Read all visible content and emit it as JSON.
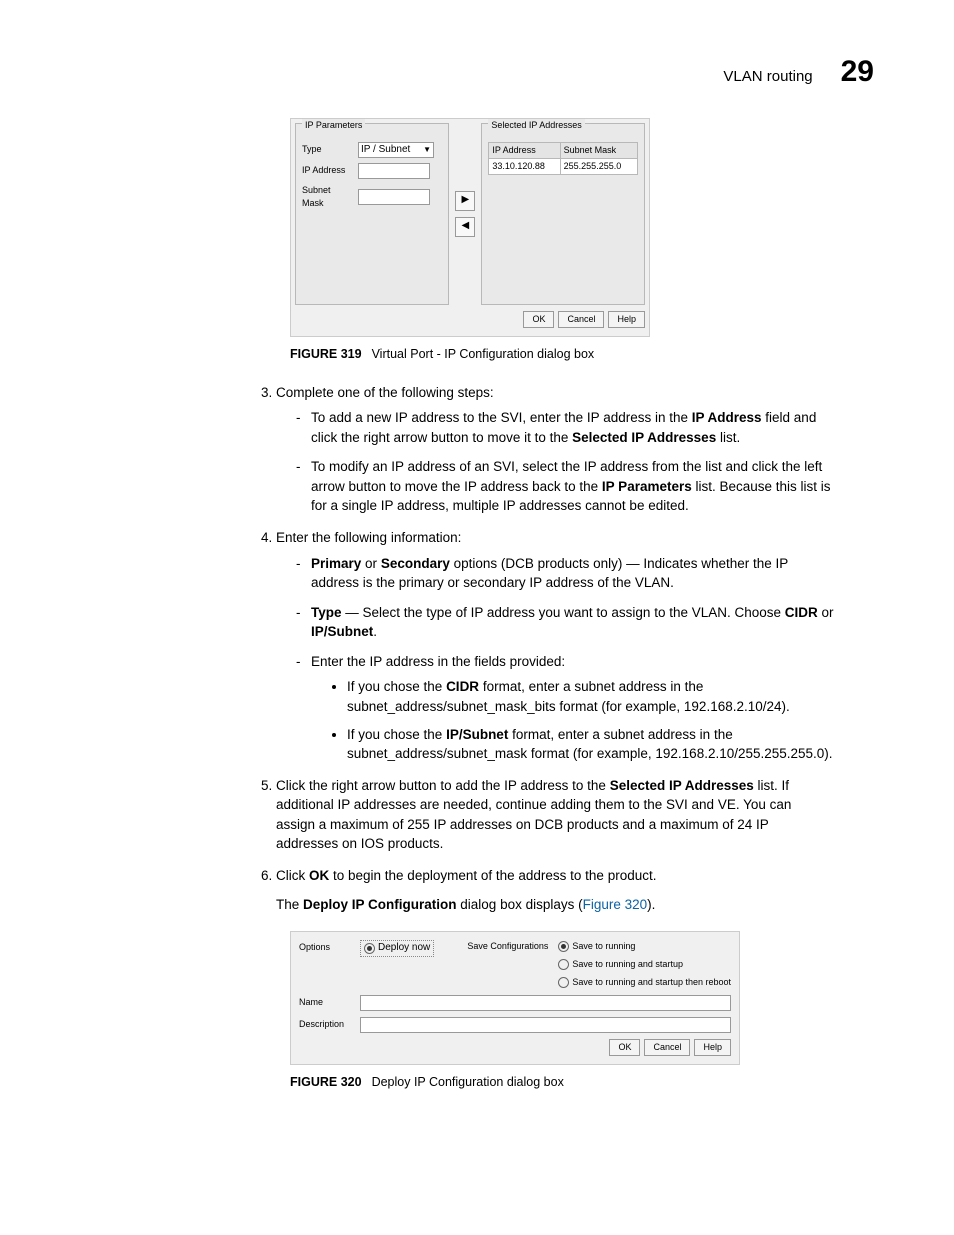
{
  "header": {
    "title": "VLAN routing",
    "chapter": "29"
  },
  "fig319": {
    "caption_label": "FIGURE 319",
    "caption_text": "Virtual Port - IP Configuration dialog box",
    "ip_params_legend": "IP Parameters",
    "type_label": "Type",
    "type_value": "IP / Subnet",
    "ip_label": "IP Address",
    "mask_label": "Subnet Mask",
    "sel_legend": "Selected IP Addresses",
    "col_ip": "IP Address",
    "col_mask": "Subnet Mask",
    "row_ip": "33.10.120.88",
    "row_mask": "255.255.255.0",
    "ok": "OK",
    "cancel": "Cancel",
    "help": "Help"
  },
  "steps": {
    "s3": "Complete one of the following steps:",
    "s3a_pre": "To add a new IP address to the SVI, enter the IP address in the ",
    "s3a_b1": "IP Address",
    "s3a_mid": " field and click the right arrow button to move it to the ",
    "s3a_b2": "Selected IP Addresses",
    "s3a_post": " list.",
    "s3b_pre": "To modify an IP address of an SVI, select the IP address from the list and click the left arrow button to move the IP address back to the ",
    "s3b_b1": "IP Parameters",
    "s3b_post": " list. Because this list is for a single IP address, multiple IP addresses cannot be edited.",
    "s4": "Enter the following information:",
    "s4a_b1": "Primary",
    "s4a_or": " or ",
    "s4a_b2": "Secondary",
    "s4a_txt": " options (DCB products only) — Indicates whether the IP address is the primary or secondary IP address of the VLAN.",
    "s4b_b1": "Type",
    "s4b_mid": " — Select the type of IP address you want to assign to the VLAN. Choose ",
    "s4b_b2": "CIDR",
    "s4b_or": " or ",
    "s4b_b3": "IP/Subnet",
    "s4b_post": ".",
    "s4c": "Enter the IP address in the fields provided:",
    "s4c1_pre": "If you chose the ",
    "s4c1_b": "CIDR",
    "s4c1_post": " format, enter a subnet address in the subnet_address/subnet_mask_bits format (for example, 192.168.2.10/24).",
    "s4c2_pre": "If you chose the ",
    "s4c2_b": "IP/Subnet",
    "s4c2_post": " format, enter a subnet address in the subnet_address/subnet_mask format (for example, 192.168.2.10/255.255.255.0).",
    "s5_pre": "Click the right arrow button to add the IP address to the ",
    "s5_b": "Selected IP Addresses",
    "s5_post": " list. If additional IP addresses are needed, continue adding them to the SVI and VE. You can assign a maximum of 255 IP addresses on DCB products and a maximum of 24 IP addresses on IOS products.",
    "s6_pre": "Click ",
    "s6_b": "OK",
    "s6_post": " to begin the deployment of the address to the product.",
    "s6_after_pre": "The ",
    "s6_after_b": "Deploy IP Configuration",
    "s6_after_mid": " dialog box displays (",
    "s6_after_link": "Figure 320",
    "s6_after_post": ")."
  },
  "fig320": {
    "caption_label": "FIGURE 320",
    "caption_text": "Deploy IP Configuration dialog box",
    "options": "Options",
    "deploy_now": "Deploy now",
    "save_conf": "Save Configurations",
    "r1": "Save to running",
    "r2": "Save to running and startup",
    "r3": "Save to running and startup then reboot",
    "name": "Name",
    "desc": "Description",
    "ok": "OK",
    "cancel": "Cancel",
    "help": "Help"
  }
}
